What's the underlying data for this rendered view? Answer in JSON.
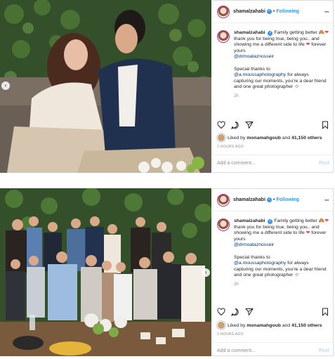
{
  "posts": [
    {
      "username": "shamalzahabi",
      "follow_label": "Following",
      "caption_user": "shamalzahabi",
      "caption_part1": "Family getting better",
      "caption_part2": "thank you for being true, being you.. and showing me a different side to life",
      "caption_part3": "forever yours",
      "mention1": "@drmoataznosseir",
      "special": "Special thanks to",
      "mention2": "@a.moussaphotography",
      "special_rest": "for always capturing our moments, you're a dear friend and one great photographer",
      "caption_time": "2h",
      "likes_prefix": "Liked by",
      "likes_user": "monamahgoub",
      "likes_and": "and",
      "likes_count": "41,150 others",
      "time_ago": "2 HOURS AGO",
      "comment_placeholder": "Add a comment...",
      "post_label": "Post"
    },
    {
      "username": "shamalzahabi",
      "follow_label": "Following",
      "caption_user": "shamalzahabi",
      "caption_part1": "Family getting better",
      "caption_part2": "thank you for being true, being you.. and showing me a different side to life",
      "caption_part3": "forever yours",
      "mention1": "@drmoataznosseir",
      "special": "Special thanks to",
      "mention2": "@a.moussaphotography",
      "special_rest": "for always capturing our moments, you're a dear friend and one great photographer",
      "caption_time": "2h",
      "likes_prefix": "Liked by",
      "likes_user": "monamahgoub",
      "likes_and": "and",
      "likes_count": "41,150 others",
      "time_ago": "2 HOURS AGO",
      "comment_placeholder": "Add a comment...",
      "post_label": "Post"
    }
  ],
  "colors": {
    "accent": "#3897f0",
    "heart": "#ed4956",
    "muted": "#8e8e8e",
    "link": "#00376b"
  },
  "icons": [
    "heart-icon",
    "comment-icon",
    "share-icon",
    "bookmark-icon",
    "more-options-icon",
    "verified-icon",
    "carousel-left-arrow-icon",
    "carousel-right-arrow-icon"
  ]
}
